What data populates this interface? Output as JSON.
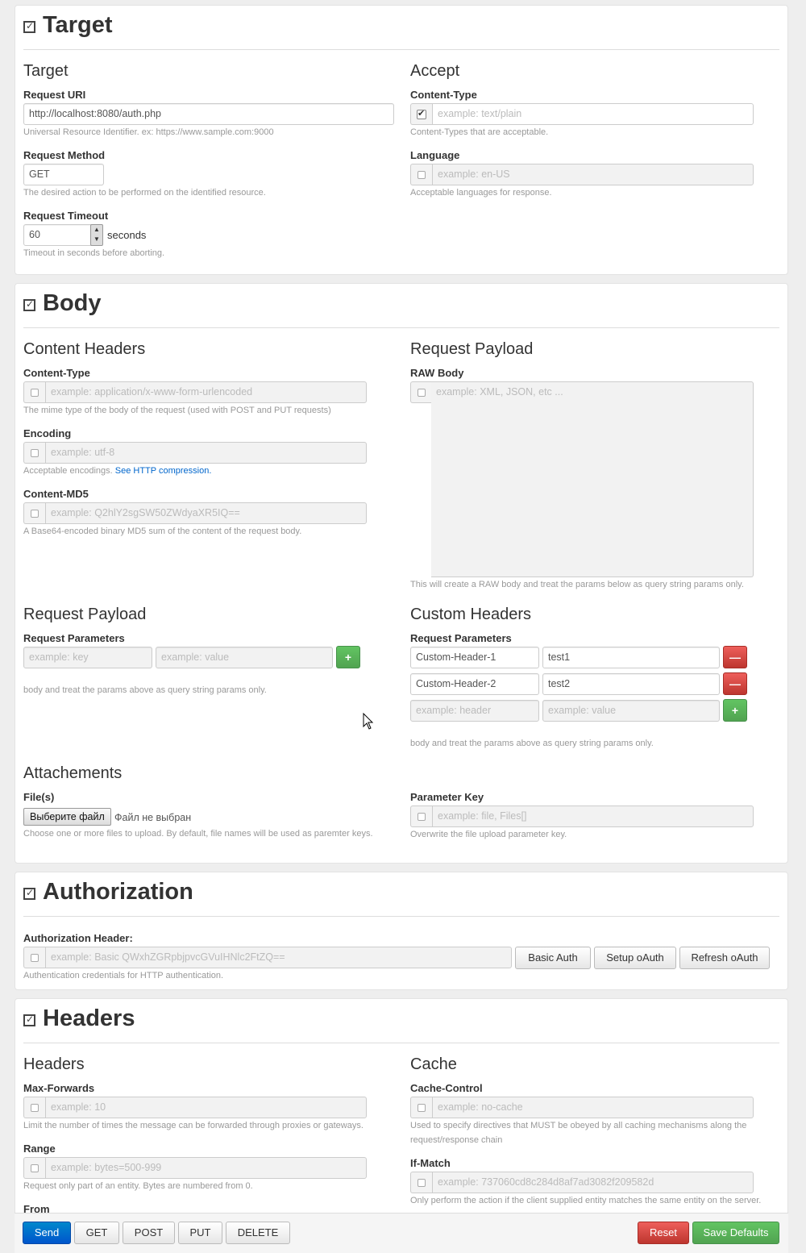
{
  "target": {
    "panel_title": "Target",
    "left_heading": "Target",
    "request_uri": {
      "label": "Request URI",
      "value": "http://localhost:8080/auth.php",
      "help": "Universal Resource Identifier. ex: https://www.sample.com:9000"
    },
    "request_method": {
      "label": "Request Method",
      "value": "GET",
      "help": "The desired action to be performed on the identified resource."
    },
    "request_timeout": {
      "label": "Request Timeout",
      "value": "60",
      "unit": "seconds",
      "help": "Timeout in seconds before aborting."
    },
    "right_heading": "Accept",
    "content_type": {
      "label": "Content-Type",
      "placeholder": "example: text/plain",
      "help": "Content-Types that are acceptable.",
      "checked": true
    },
    "language": {
      "label": "Language",
      "placeholder": "example: en-US",
      "help": "Acceptable languages for response."
    }
  },
  "body": {
    "panel_title": "Body",
    "content_headers": {
      "heading": "Content Headers",
      "content_type": {
        "label": "Content-Type",
        "placeholder": "example: application/x-www-form-urlencoded",
        "help": "The mime type of the body of the request (used with POST and PUT requests)"
      },
      "encoding": {
        "label": "Encoding",
        "placeholder": "example: utf-8",
        "help": "Acceptable encodings.",
        "link": "See HTTP compression."
      },
      "content_md5": {
        "label": "Content-MD5",
        "placeholder": "example: Q2hlY2sgSW50ZWdyaXR5IQ==",
        "help": "A Base64-encoded binary MD5 sum of the content of the request body."
      }
    },
    "raw_payload": {
      "heading": "Request Payload",
      "label": "RAW Body",
      "placeholder": "example: XML, JSON, etc ...",
      "help": "This will create a RAW body and treat the params below as query string params only."
    },
    "params_payload": {
      "heading": "Request Payload",
      "label": "Request Parameters",
      "key_placeholder": "example: key",
      "value_placeholder": "example: value",
      "add": "+",
      "help": "body and treat the params above as query string params only."
    },
    "custom_headers": {
      "heading": "Custom Headers",
      "label": "Request Parameters",
      "rows": [
        {
          "key": "Custom-Header-1",
          "value": "test1",
          "remove": "—"
        },
        {
          "key": "Custom-Header-2",
          "value": "test2",
          "remove": "—"
        }
      ],
      "key_placeholder": "example: header",
      "value_placeholder": "example: value",
      "add": "+",
      "help": "body and treat the params above as query string params only."
    },
    "attachments": {
      "heading": "Attachements",
      "files_label": "File(s)",
      "file_button": "Выберите файл",
      "file_status": "Файл не выбран",
      "files_help": "Choose one or more files to upload. By default, file names will be used as paremter keys.",
      "key_label": "Parameter Key",
      "key_placeholder": "example: file, Files[]",
      "key_help": "Overwrite the file upload parameter key."
    }
  },
  "authorization": {
    "panel_title": "Authorization",
    "label": "Authorization Header:",
    "placeholder": "example: Basic QWxhZGRpbjpvcGVuIHNlc2FtZQ==",
    "help": "Authentication credentials for HTTP authentication.",
    "basic_auth": "Basic Auth",
    "setup_oauth": "Setup oAuth",
    "refresh_oauth": "Refresh oAuth"
  },
  "headers": {
    "panel_title": "Headers",
    "left_heading": "Headers",
    "max_forwards": {
      "label": "Max-Forwards",
      "placeholder": "example: 10",
      "help": "Limit the number of times the message can be forwarded through proxies or gateways."
    },
    "range": {
      "label": "Range",
      "placeholder": "example: bytes=500-999",
      "help": "Request only part of an entity. Bytes are numbered from 0."
    },
    "from": {
      "label": "From"
    },
    "right_heading": "Cache",
    "cache_control": {
      "label": "Cache-Control",
      "placeholder": "example: no-cache",
      "help": "Used to specify directives that MUST be obeyed by all caching mechanisms along the request/response chain"
    },
    "if_match": {
      "label": "If-Match",
      "placeholder": "example: 737060cd8c284d8af7ad3082f209582d",
      "help": "Only perform the action if the client supplied entity matches the same entity on the server."
    }
  },
  "footer": {
    "send": "Send",
    "get": "GET",
    "post": "POST",
    "put": "PUT",
    "delete": "DELETE",
    "reset": "Reset",
    "save_defaults": "Save Defaults"
  }
}
